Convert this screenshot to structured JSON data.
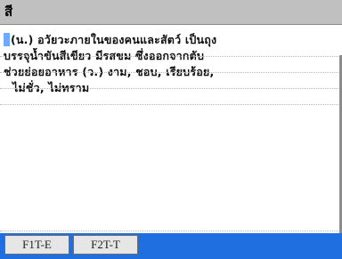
{
  "dictionary": {
    "headword": "สี",
    "definition_lines": [
      "(น.) อวัยวะภายในของคนและสัตว์ เป็นถุง",
      "บรรจุน้ำขันสีเขียว มีรสขม ซึ่งออกจากตับ",
      "ช่วยย่อยอาหาร (ว.) งาม, ชอบ, เรียบร้อย,",
      "ไม่ชั่ว, ไม่ทราม"
    ]
  },
  "softkeys": {
    "f1_label": "F1T-E",
    "f2_label": "F2T-T"
  },
  "colors": {
    "header_bg": "#c0c0c0",
    "footer_bg": "#1f6fe0",
    "cursor": "#6fa8ff"
  }
}
